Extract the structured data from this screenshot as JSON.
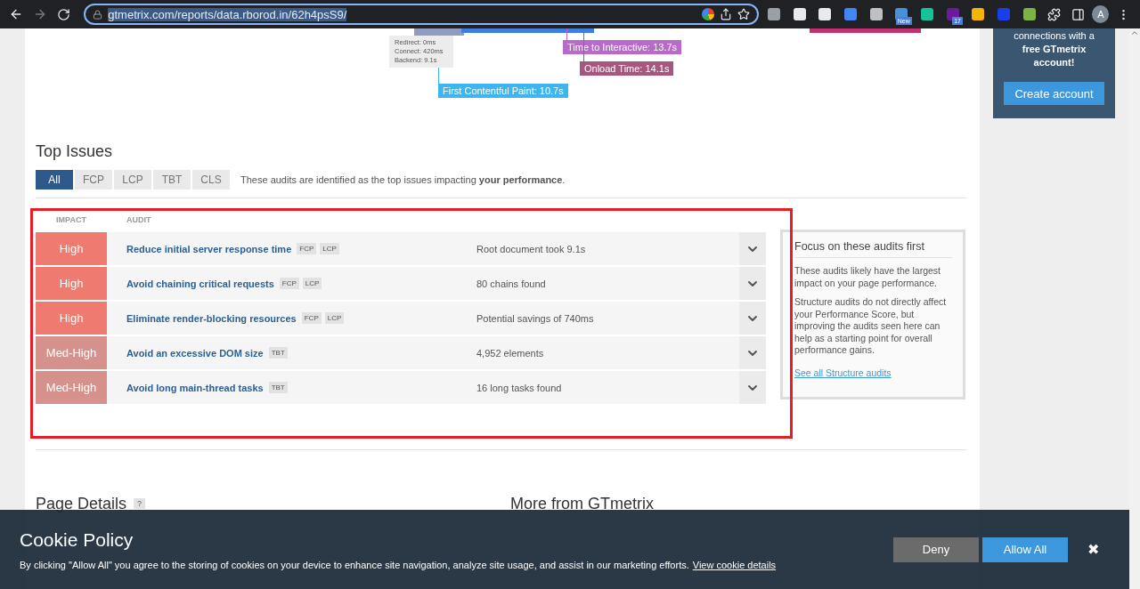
{
  "browser": {
    "url": "gtmetrix.com/reports/data.rborod.in/62h4psS9/",
    "extensions": [
      {
        "color": "#9aa0a6"
      },
      {
        "color": "#e8eaed"
      },
      {
        "color": "#e8eaed"
      },
      {
        "color": "#4285f4"
      },
      {
        "color": "#bdc1c6"
      },
      {
        "color": "#4a90d9",
        "badge": "New"
      },
      {
        "color": "#15c39a"
      },
      {
        "color": "#6a1b9a",
        "badge": "17"
      },
      {
        "color": "#f4b400"
      },
      {
        "color": "#1a3ee8"
      },
      {
        "color": "#7cb342"
      }
    ],
    "avatar": "A"
  },
  "timeline": {
    "ttfb_details": [
      "Redirect: 0ms",
      "Connect: 420ms",
      "Backend: 9.1s"
    ],
    "markers": [
      {
        "label": "Time to Interactive: 13.7s",
        "color": "#b76bc9"
      },
      {
        "label": "Onload Time: 14.1s",
        "color": "#a5577e"
      },
      {
        "label": "First Contentful Paint: 10.7s",
        "color": "#3db5ef"
      }
    ]
  },
  "promo": {
    "text": "connections with a",
    "bold_text": "free GTmetrix account!",
    "button": "Create account"
  },
  "top_issues": {
    "title": "Top Issues",
    "tabs": [
      {
        "label": "All",
        "selected": true
      },
      {
        "label": "FCP",
        "selected": false
      },
      {
        "label": "LCP",
        "selected": false
      },
      {
        "label": "TBT",
        "selected": false
      },
      {
        "label": "CLS",
        "selected": false
      }
    ],
    "intro": "These audits are identified as the top issues impacting **your performance**.",
    "columns": [
      "IMPACT",
      "AUDIT"
    ],
    "rows": [
      {
        "impact": "High",
        "color": "#ef7b70",
        "audit": "Reduce initial server response time",
        "tags": [
          "FCP",
          "LCP"
        ],
        "result": "Root document took 9.1s"
      },
      {
        "impact": "High",
        "color": "#ef7b70",
        "audit": "Avoid chaining critical requests",
        "tags": [
          "FCP",
          "LCP"
        ],
        "result": "80 chains found"
      },
      {
        "impact": "High",
        "color": "#ef7b70",
        "audit": "Eliminate render-blocking resources",
        "tags": [
          "FCP",
          "LCP"
        ],
        "result": "Potential savings of 740ms"
      },
      {
        "impact": "Med-High",
        "color": "#d6918c",
        "audit": "Avoid an excessive DOM size",
        "tags": [
          "TBT"
        ],
        "result": "4,952 elements"
      },
      {
        "impact": "Med-High",
        "color": "#d6918c",
        "audit": "Avoid long main-thread tasks",
        "tags": [
          "TBT"
        ],
        "result": "16 long tasks found"
      }
    ],
    "focus": {
      "title": "Focus on these audits first",
      "paragraphs": [
        "These audits likely have the largest impact on your page performance.",
        "Structure audits do not directly affect your Performance Score, but improving the audits seen here can help as a starting point for overall performance gains."
      ],
      "link": "See all Structure audits"
    }
  },
  "page_details": {
    "title": "Page Details",
    "help": "?"
  },
  "more": {
    "title": "More from GTmetrix"
  },
  "cookie": {
    "title": "Cookie Policy",
    "text": "By clicking \"Allow All\" you agree to the storing of cookies on your device to enhance site navigation, analyze site usage, and assist in our marketing efforts.",
    "link": "View cookie details",
    "buttons": [
      {
        "label": "Deny",
        "kind": "deny"
      },
      {
        "label": "Allow All",
        "kind": "allow"
      }
    ],
    "close": "✖"
  }
}
